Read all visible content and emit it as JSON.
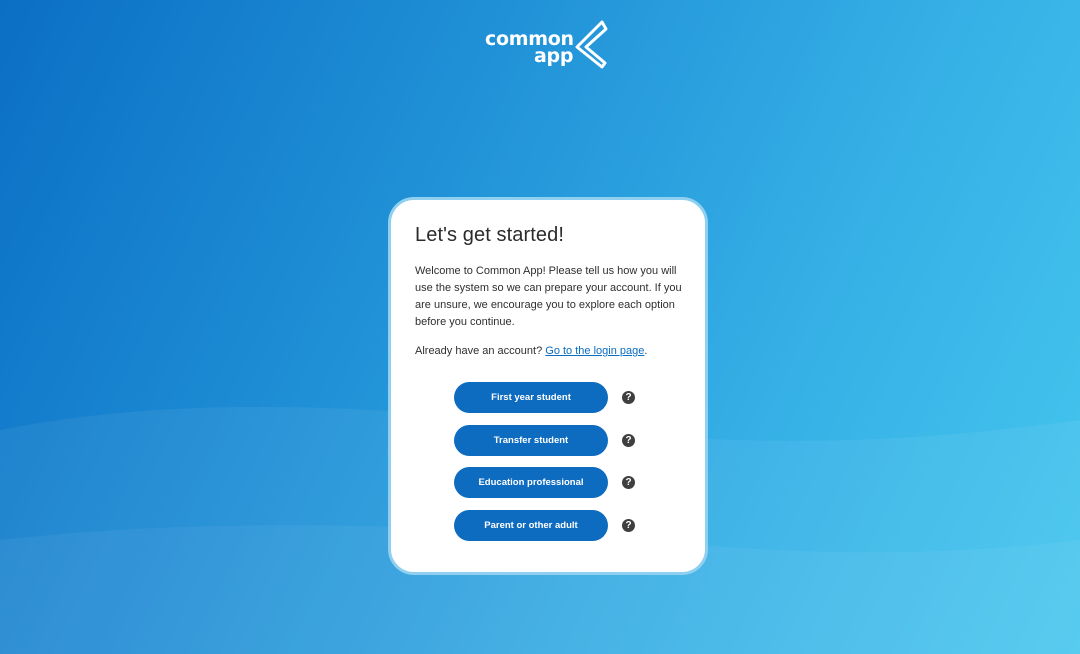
{
  "brand": {
    "line1": "common",
    "line2": "app"
  },
  "card": {
    "title": "Let's get started!",
    "intro": "Welcome to Common App! Please tell us how you will use the system so we can prepare your account. If you are unsure, we encourage you to explore each option before you continue.",
    "login_prompt": "Already have an account? ",
    "login_link": "Go to the login page",
    "login_suffix": "."
  },
  "options": [
    {
      "label": "First year student",
      "help_icon": "question-circle-icon"
    },
    {
      "label": "Transfer student",
      "help_icon": "question-circle-icon"
    },
    {
      "label": "Education professional",
      "help_icon": "question-circle-icon"
    },
    {
      "label": "Parent or other adult",
      "help_icon": "question-circle-icon"
    }
  ],
  "colors": {
    "background_start": "#0b6fc4",
    "background_end": "#45c7ee",
    "button": "#0d6bc0",
    "link": "#0a6cc2",
    "card_border": "#8fd0f0",
    "help_icon": "#3f3f3f"
  }
}
